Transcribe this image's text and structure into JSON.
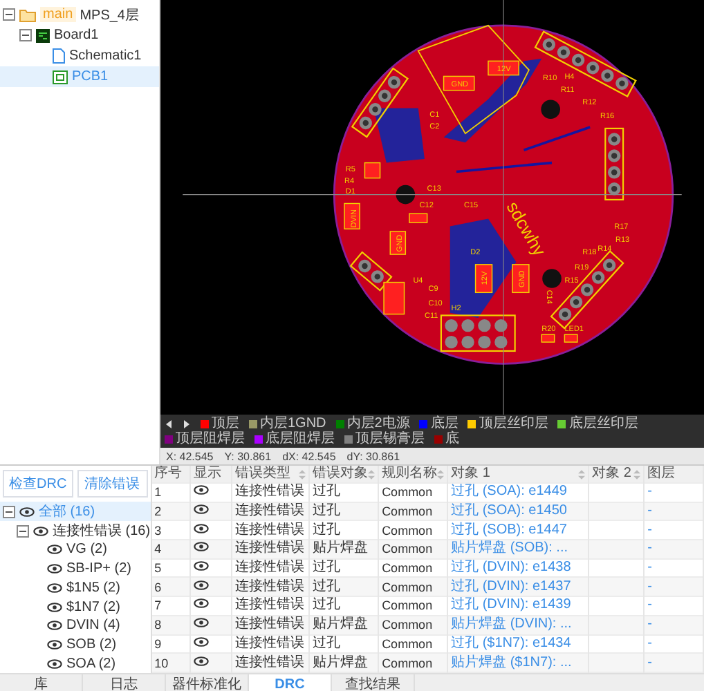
{
  "project_tree": [
    {
      "label": "MPS_4层",
      "badge": "main",
      "kind": "project",
      "expanded": true,
      "selected": false,
      "children": [
        {
          "label": "Board1",
          "kind": "board",
          "expanded": true,
          "selected": false,
          "children": [
            {
              "label": "Schematic1",
              "kind": "schematic",
              "selected": false
            },
            {
              "label": "PCB1",
              "kind": "pcb",
              "selected": true
            }
          ]
        }
      ]
    }
  ],
  "canvas": {
    "labels": [
      "R10",
      "R11",
      "R12",
      "R16",
      "H4",
      "C1",
      "C2",
      "R5",
      "R4",
      "D1",
      "C13",
      "C12",
      "C15",
      "D2",
      "U4",
      "C9",
      "C10",
      "C11",
      "H2",
      "R20",
      "LED1",
      "R17",
      "R13",
      "R14",
      "R18",
      "R19",
      "R15",
      "C14",
      "12V",
      "GND",
      "12V",
      "GND",
      "DVIN",
      "GND",
      "sdcwhy"
    ]
  },
  "layers": [
    {
      "name": "顶层",
      "color": "#ff0000"
    },
    {
      "name": "内层1GND",
      "color": "#999966"
    },
    {
      "name": "内层2电源",
      "color": "#008000"
    },
    {
      "name": "底层",
      "color": "#0000ff"
    },
    {
      "name": "顶层丝印层",
      "color": "#ffcc00"
    },
    {
      "name": "底层丝印层",
      "color": "#66cc33"
    },
    {
      "name": "顶层阻焊层",
      "color": "#800080"
    },
    {
      "name": "底层阻焊层",
      "color": "#aa00ff"
    },
    {
      "name": "顶层锡膏层",
      "color": "#808080"
    },
    {
      "name": "底",
      "color": "#990000"
    }
  ],
  "coordinates": [
    "X: 42.545",
    "Y: 30.861",
    "dX: 42.545",
    "dY: 30.861"
  ],
  "drc": {
    "buttons": [
      "检查DRC",
      "清除错误"
    ],
    "tree": [
      {
        "label": "全部 (16)",
        "selected": true,
        "expanded": true,
        "children": [
          {
            "label": "连接性错误 (16)",
            "selected": false,
            "expanded": true,
            "children": [
              {
                "label": "VG (2)",
                "selected": false
              },
              {
                "label": "SB-IP+ (2)",
                "selected": false
              },
              {
                "label": "$1N5 (2)",
                "selected": false
              },
              {
                "label": "$1N7 (2)",
                "selected": false
              },
              {
                "label": "DVIN (4)",
                "selected": false
              },
              {
                "label": "SOB (2)",
                "selected": false
              },
              {
                "label": "SOA (2)",
                "selected": false
              }
            ]
          }
        ]
      }
    ]
  },
  "table": {
    "columns": [
      {
        "label": "序号",
        "sortable": false
      },
      {
        "label": "显示",
        "sortable": false
      },
      {
        "label": "错误类型",
        "sortable": true
      },
      {
        "label": "错误对象",
        "sortable": true
      },
      {
        "label": "规则名称",
        "sortable": true
      },
      {
        "label": "对象 1",
        "sortable": true
      },
      {
        "label": "对象 2",
        "sortable": true
      },
      {
        "label": "图层",
        "sortable": false
      }
    ],
    "rows": [
      {
        "no": "1",
        "error_type": "连接性错误",
        "error_object": "过孔",
        "rule": "Common",
        "object_1": "过孔 (SOA): e1449",
        "layer": "-"
      },
      {
        "no": "2",
        "error_type": "连接性错误",
        "error_object": "过孔",
        "rule": "Common",
        "object_1": "过孔 (SOA): e1450",
        "layer": "-"
      },
      {
        "no": "3",
        "error_type": "连接性错误",
        "error_object": "过孔",
        "rule": "Common",
        "object_1": "过孔 (SOB): e1447",
        "layer": "-"
      },
      {
        "no": "4",
        "error_type": "连接性错误",
        "error_object": "贴片焊盘",
        "rule": "Common",
        "object_1": "贴片焊盘 (SOB): ...",
        "layer": "-"
      },
      {
        "no": "5",
        "error_type": "连接性错误",
        "error_object": "过孔",
        "rule": "Common",
        "object_1": "过孔 (DVIN): e1438",
        "layer": "-"
      },
      {
        "no": "6",
        "error_type": "连接性错误",
        "error_object": "过孔",
        "rule": "Common",
        "object_1": "过孔 (DVIN): e1437",
        "layer": "-"
      },
      {
        "no": "7",
        "error_type": "连接性错误",
        "error_object": "过孔",
        "rule": "Common",
        "object_1": "过孔 (DVIN): e1439",
        "layer": "-"
      },
      {
        "no": "8",
        "error_type": "连接性错误",
        "error_object": "贴片焊盘",
        "rule": "Common",
        "object_1": "贴片焊盘 (DVIN): ...",
        "layer": "-"
      },
      {
        "no": "9",
        "error_type": "连接性错误",
        "error_object": "过孔",
        "rule": "Common",
        "object_1": "过孔 ($1N7): e1434",
        "layer": "-"
      },
      {
        "no": "10",
        "error_type": "连接性错误",
        "error_object": "贴片焊盘",
        "rule": "Common",
        "object_1": "贴片焊盘 ($1N7): ...",
        "layer": "-"
      }
    ]
  },
  "bottom_tabs": [
    {
      "label": "库",
      "selected": false
    },
    {
      "label": "日志",
      "selected": false
    },
    {
      "label": "器件标准化",
      "selected": false
    },
    {
      "label": "DRC",
      "selected": true
    },
    {
      "label": "查找结果",
      "selected": false
    }
  ]
}
